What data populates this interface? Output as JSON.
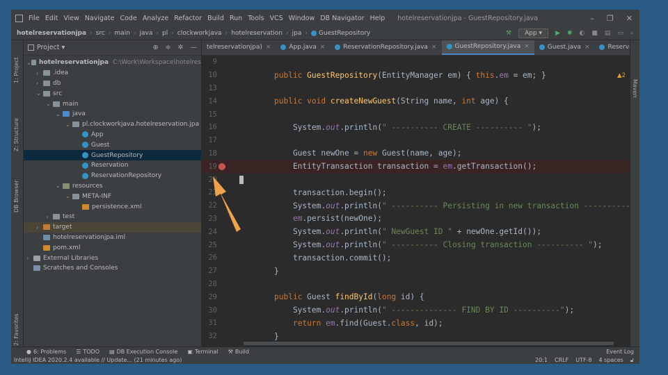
{
  "menu": {
    "items": [
      "File",
      "Edit",
      "View",
      "Navigate",
      "Code",
      "Analyze",
      "Refactor",
      "Build",
      "Run",
      "Tools",
      "VCS",
      "Window",
      "DB Navigator",
      "Help"
    ],
    "window_title": "hotelreservationjpa - GuestRepository.java"
  },
  "breadcrumbs": [
    "hotelreservationjpa",
    "src",
    "main",
    "java",
    "pl",
    "clockworkjava",
    "hotelreservation",
    "jpa",
    "GuestRepository"
  ],
  "run_config": "App",
  "project": {
    "title": "Project",
    "tree": [
      {
        "label": "hotelreservationjpa",
        "extra": "C:\\Work\\Workspace\\hotelres",
        "arrow": "⌄",
        "icon": "folder",
        "indent": 0
      },
      {
        "label": ".idea",
        "arrow": "›",
        "icon": "folder",
        "indent": 1
      },
      {
        "label": "db",
        "arrow": "›",
        "icon": "folder",
        "indent": 1
      },
      {
        "label": "src",
        "arrow": "⌄",
        "icon": "folder",
        "indent": 1
      },
      {
        "label": "main",
        "arrow": "⌄",
        "icon": "folder",
        "indent": 2
      },
      {
        "label": "java",
        "arrow": "⌄",
        "icon": "src",
        "indent": 3
      },
      {
        "label": "pl.clockworkjava.hotelreservation.jpa",
        "arrow": "⌄",
        "icon": "folder",
        "indent": 4
      },
      {
        "label": "App",
        "arrow": "",
        "icon": "cls",
        "indent": 5
      },
      {
        "label": "Guest",
        "arrow": "",
        "icon": "cls",
        "indent": 5
      },
      {
        "label": "GuestRepository",
        "arrow": "",
        "icon": "cls",
        "indent": 5,
        "selected": true
      },
      {
        "label": "Reservation",
        "arrow": "",
        "icon": "cls",
        "indent": 5
      },
      {
        "label": "ReservationRepository",
        "arrow": "",
        "icon": "cls",
        "indent": 5
      },
      {
        "label": "resources",
        "arrow": "⌄",
        "icon": "res",
        "indent": 3
      },
      {
        "label": "META-INF",
        "arrow": "⌄",
        "icon": "folder",
        "indent": 4
      },
      {
        "label": "persistence.xml",
        "arrow": "",
        "icon": "xml",
        "indent": 5
      },
      {
        "label": "test",
        "arrow": "›",
        "icon": "folder",
        "indent": 2
      },
      {
        "label": "target",
        "arrow": "›",
        "icon": "excl",
        "indent": 1,
        "highlight": true
      },
      {
        "label": "hotelreservationjpa.iml",
        "arrow": "",
        "icon": "iml",
        "indent": 1
      },
      {
        "label": "pom.xml",
        "arrow": "",
        "icon": "xml",
        "indent": 1
      },
      {
        "label": "External Libraries",
        "arrow": "›",
        "icon": "lib",
        "indent": 0
      },
      {
        "label": "Scratches and Consoles",
        "arrow": "",
        "icon": "scr",
        "indent": 0
      }
    ]
  },
  "tabs": [
    {
      "label": "telreservationjpa)",
      "close": "×",
      "active": false
    },
    {
      "label": "App.java",
      "close": "×",
      "active": false
    },
    {
      "label": "ReservationRepository.java",
      "close": "×",
      "active": false
    },
    {
      "label": "GuestRepository.java",
      "close": "×",
      "active": true
    },
    {
      "label": "Guest.java",
      "close": "×",
      "active": false
    },
    {
      "label": "Reservation.java",
      "close": "×",
      "active": false
    }
  ],
  "editor": {
    "warning_count": "▲2",
    "breakpoint_line": "19",
    "caret_line": "20",
    "lines": [
      {
        "n": "9",
        "tokens": []
      },
      {
        "n": "10",
        "tokens": [
          [
            "kw",
            "public "
          ],
          [
            "fn",
            "GuestRepository"
          ],
          [
            "",
            "(EntityManager em) { "
          ],
          [
            "kw",
            "this"
          ],
          [
            "",
            "."
          ],
          [
            "fld",
            "em"
          ],
          [
            "",
            " = em; }"
          ]
        ]
      },
      {
        "n": "13",
        "tokens": []
      },
      {
        "n": "14",
        "tokens": [
          [
            "kw",
            "public void "
          ],
          [
            "fn",
            "createNewGuest"
          ],
          [
            "",
            "(String name, "
          ],
          [
            "kw",
            "int "
          ],
          [
            "",
            "age) {"
          ]
        ]
      },
      {
        "n": "15",
        "tokens": []
      },
      {
        "n": "16",
        "tokens": [
          [
            "",
            "    System."
          ],
          [
            "it",
            "out"
          ],
          [
            "",
            ".println("
          ],
          [
            "st",
            "\" ---------- CREATE ---------- \""
          ],
          [
            "",
            ");"
          ]
        ]
      },
      {
        "n": "17",
        "tokens": []
      },
      {
        "n": "18",
        "tokens": [
          [
            "",
            "    Guest newOne = "
          ],
          [
            "kw",
            "new "
          ],
          [
            "",
            "Guest(name, age);"
          ]
        ]
      },
      {
        "n": "19",
        "tokens": [
          [
            "",
            "    EntityTransaction transaction = "
          ],
          [
            "fld",
            "em"
          ],
          [
            "",
            ".getTransaction();"
          ]
        ]
      },
      {
        "n": "20",
        "tokens": []
      },
      {
        "n": "21",
        "tokens": [
          [
            "",
            "    transaction.begin();"
          ]
        ]
      },
      {
        "n": "22",
        "tokens": [
          [
            "",
            "    System."
          ],
          [
            "it",
            "out"
          ],
          [
            "",
            ".println("
          ],
          [
            "st",
            "\" ---------- Persisting in new transaction ----------"
          ]
        ]
      },
      {
        "n": "23",
        "tokens": [
          [
            "",
            "    "
          ],
          [
            "fld",
            "em"
          ],
          [
            "",
            ".persist(newOne);"
          ]
        ]
      },
      {
        "n": "24",
        "tokens": [
          [
            "",
            "    System."
          ],
          [
            "it",
            "out"
          ],
          [
            "",
            ".println("
          ],
          [
            "st",
            "\" NewGuest ID \""
          ],
          [
            "",
            " + newOne.getId());"
          ]
        ]
      },
      {
        "n": "25",
        "tokens": [
          [
            "",
            "    System."
          ],
          [
            "it",
            "out"
          ],
          [
            "",
            ".println("
          ],
          [
            "st",
            "\" ---------- Closing transaction ---------- \""
          ],
          [
            "",
            ");"
          ]
        ]
      },
      {
        "n": "26",
        "tokens": [
          [
            "",
            "    transaction.commit();"
          ]
        ]
      },
      {
        "n": "27",
        "tokens": [
          [
            "",
            "}"
          ]
        ]
      },
      {
        "n": "28",
        "tokens": []
      },
      {
        "n": "29",
        "tokens": [
          [
            "kw",
            "public "
          ],
          [
            "",
            "Guest "
          ],
          [
            "fn",
            "findById"
          ],
          [
            "",
            "("
          ],
          [
            "kw",
            "long "
          ],
          [
            "",
            "id) {"
          ]
        ]
      },
      {
        "n": "30",
        "tokens": [
          [
            "",
            "    System."
          ],
          [
            "it",
            "out"
          ],
          [
            "",
            ".println("
          ],
          [
            "st",
            "\" -------------- FIND BY ID ----------\""
          ],
          [
            "",
            ");"
          ]
        ]
      },
      {
        "n": "31",
        "tokens": [
          [
            "",
            "    "
          ],
          [
            "kw",
            "return "
          ],
          [
            "fld",
            "em"
          ],
          [
            "",
            ".find(Guest."
          ],
          [
            "kw",
            "class"
          ],
          [
            "",
            ", id);"
          ]
        ]
      },
      {
        "n": "32",
        "tokens": [
          [
            "",
            "}"
          ]
        ]
      }
    ]
  },
  "left_tools": [
    "1: Project",
    "Z: Structure",
    "DB Browser",
    "2: Favorites"
  ],
  "right_tools": [
    "Maven"
  ],
  "bottom_tools": [
    {
      "label": "6: Problems"
    },
    {
      "label": "TODO"
    },
    {
      "label": "DB Execution Console"
    },
    {
      "label": "Terminal"
    },
    {
      "label": "Build"
    }
  ],
  "event_log": "Event Log",
  "status": {
    "message": "IntelliJ IDEA 2020.2.4 available // Update... (21 minutes ago)",
    "position": "20:1",
    "line_sep": "CRLF",
    "encoding": "UTF-8",
    "indent": "4 spaces"
  },
  "colors": {
    "accent": "#4a88c7",
    "breakpoint": "#c75450",
    "annotation_arrow": "#f0a24a"
  }
}
